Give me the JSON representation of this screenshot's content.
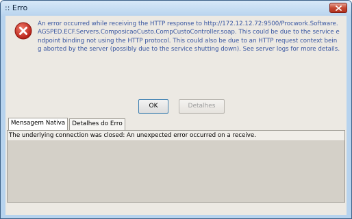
{
  "window": {
    "title": "Erro"
  },
  "message": {
    "text": "An error occurred while receiving the HTTP response to http://172.12.12.72:9500/Procwork.Software.AGSPED.ECF.Servers.ComposicaoCusto.CompCustoController.soap. This could be due to the service endpoint binding not using the HTTP protocol. This could also be due to an HTTP request context being aborted by the server (possibly due to the service shutting down). See server logs for more details."
  },
  "buttons": {
    "ok_label": "OK",
    "details_label": "Detalhes"
  },
  "tabs": [
    {
      "label": "Mensagem Nativa",
      "active": true
    },
    {
      "label": "Detalhes do Erro",
      "active": false
    }
  ],
  "panel": {
    "text": "The underlying connection was closed: An unexpected error occurred on a receive."
  },
  "icons": {
    "error": "error-icon",
    "close": "close-icon"
  },
  "colors": {
    "message_text": "#3856a1",
    "close_button": "#c54a33",
    "error_icon": "#c8261b"
  }
}
